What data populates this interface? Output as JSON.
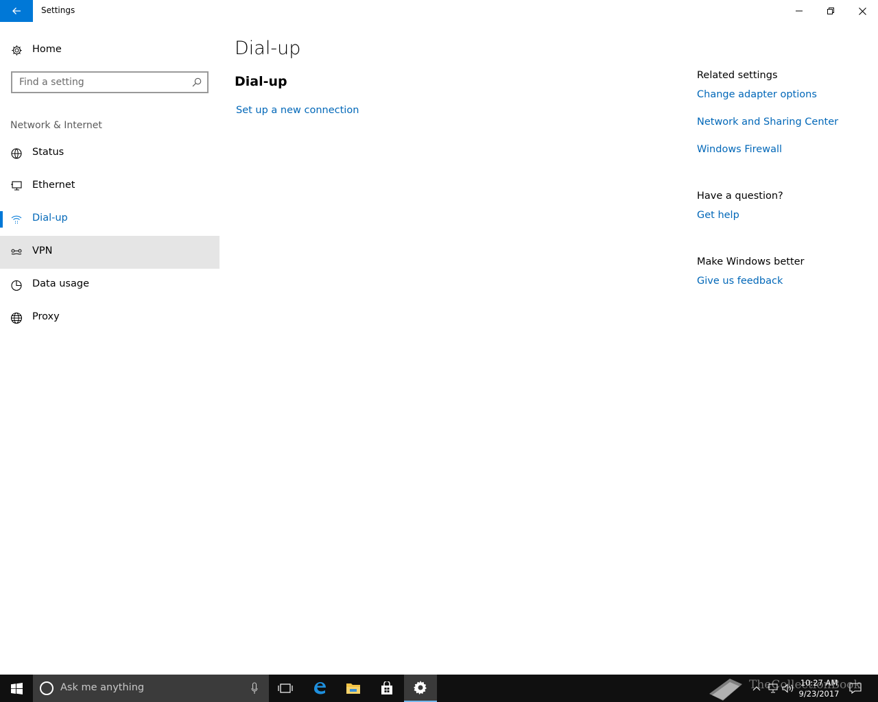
{
  "window": {
    "title": "Settings"
  },
  "sidebar": {
    "home_label": "Home",
    "search_placeholder": "Find a setting",
    "section_title": "Network & Internet",
    "items": [
      {
        "label": "Status",
        "icon": "globe-status-icon"
      },
      {
        "label": "Ethernet",
        "icon": "ethernet-icon"
      },
      {
        "label": "Dial-up",
        "icon": "dial-up-icon",
        "selected": true
      },
      {
        "label": "VPN",
        "icon": "vpn-icon",
        "hovered": true
      },
      {
        "label": "Data usage",
        "icon": "data-usage-icon"
      },
      {
        "label": "Proxy",
        "icon": "globe-icon"
      }
    ]
  },
  "main": {
    "title": "Dial-up",
    "subtitle": "Dial-up",
    "setup_link": "Set up a new connection"
  },
  "related": {
    "heading": "Related settings",
    "links": [
      "Change adapter options",
      "Network and Sharing Center",
      "Windows Firewall"
    ]
  },
  "question": {
    "heading": "Have a question?",
    "link": "Get help"
  },
  "better": {
    "heading": "Make Windows better",
    "link": "Give us feedback"
  },
  "taskbar": {
    "search_placeholder": "Ask me anything",
    "time": "10:27 AM",
    "date": "9/23/2017",
    "watermark": "TheCollectionBook"
  },
  "colors": {
    "accent": "#0078d7",
    "link": "#0067b8",
    "taskbar": "#101010"
  }
}
